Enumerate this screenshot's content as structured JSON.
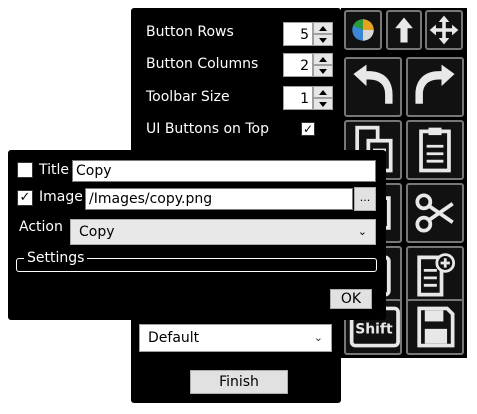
{
  "settings": {
    "rows_label": "Button Rows",
    "rows_value": "5",
    "columns_label": "Button Columns",
    "columns_value": "2",
    "toolbar_size_label": "Toolbar Size",
    "toolbar_size_value": "1",
    "ui_top_label": "UI Buttons on Top",
    "ui_top_checked": "✓",
    "theme_value": "Default",
    "finish_label": "Finish",
    "dropdown_chevron": "⌄"
  },
  "toolbar": {
    "buttons": [
      "pie-chart-icon",
      "up-arrow-icon",
      "move-icon",
      "undo-icon",
      "redo-icon",
      "copy-icon",
      "clipboard-icon",
      "paste-icon",
      "scissors-icon",
      "alt-key-icon",
      "new-document-icon",
      "shift-key-icon",
      "save-icon"
    ],
    "shift_label": "Shift"
  },
  "dialog": {
    "title_label": "Title",
    "title_checked": "",
    "title_value": "Copy",
    "image_label": "Image",
    "image_checked": "✓",
    "image_value": "/Images/copy.png",
    "browse_label": "...",
    "action_label": "Action",
    "action_value": "Copy",
    "settings_label": "Settings",
    "ok_label": "OK",
    "dropdown_chevron": "⌄"
  }
}
